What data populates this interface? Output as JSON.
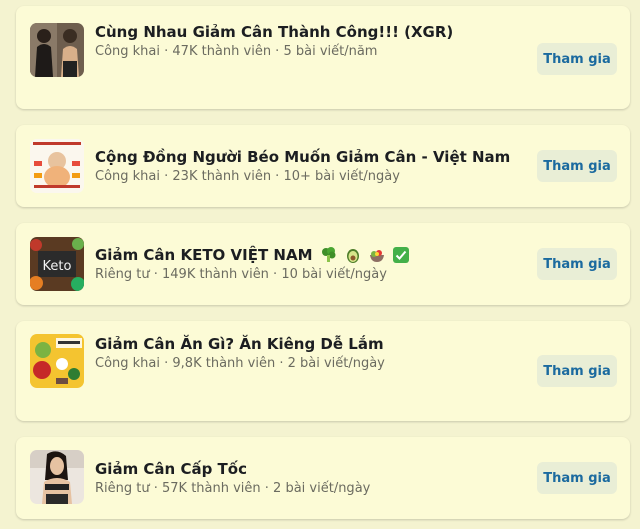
{
  "groups": [
    {
      "name": "Cùng Nhau Giảm Cân Thành Công!!! (XGR)",
      "meta": "Công khai · 47K thành viên · 5 bài viết/năm",
      "button": "Tham gia",
      "thumb_icon": "two-people-photo"
    },
    {
      "name": "Cộng Đồng Người Béo Muốn Giảm Cân - Việt Nam",
      "meta": "Công khai · 23K thành viên · 10+ bài viết/ngày",
      "button": "Tham gia",
      "thumb_icon": "infographic-image"
    },
    {
      "name": "Giảm Cân KETO VIỆT NAM",
      "meta": "Riêng tư · 149K thành viên · 10 bài viết/ngày",
      "button": "Tham gia",
      "thumb_icon": "keto-food-image",
      "emojis": [
        "broccoli-emoji",
        "avocado-emoji",
        "salad-emoji",
        "check-mark-emoji"
      ]
    },
    {
      "name": "Giảm Cân Ăn Gì? Ăn Kiêng Dễ Lắm",
      "meta": "Công khai · 9,8K thành viên · 2 bài viết/ngày",
      "button": "Tham gia",
      "thumb_icon": "food-banner-image"
    },
    {
      "name": "Giảm Cân Cấp Tốc",
      "meta": "Riêng tư · 57K thành viên · 2 bài viết/ngày",
      "button": "Tham gia",
      "thumb_icon": "person-photo"
    }
  ],
  "colors": {
    "background": "#f4f3d0",
    "card": "#fcfbd6",
    "button_bg": "#e9eed6",
    "button_text": "#1b6a9f"
  }
}
